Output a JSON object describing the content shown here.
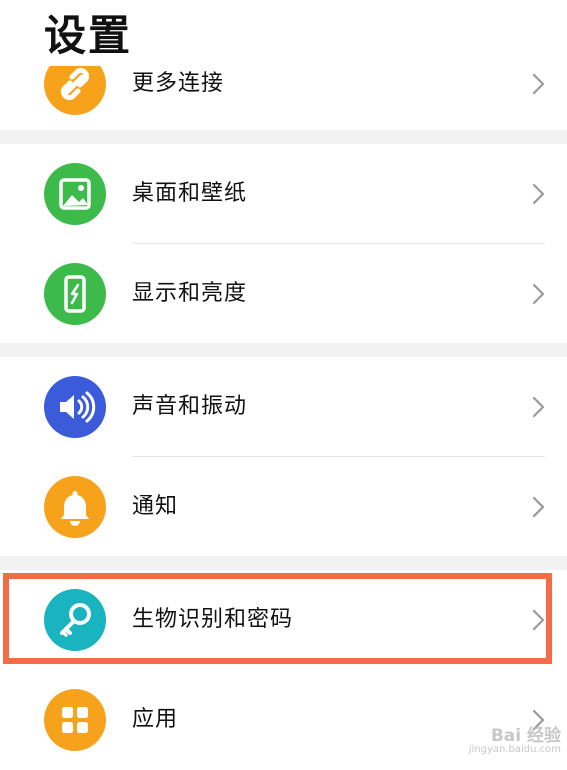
{
  "header": {
    "title": "设置"
  },
  "settings_items": [
    {
      "label": "更多连接",
      "icon": "link-icon",
      "color": "#f7a21b"
    },
    {
      "label": "桌面和壁纸",
      "icon": "image-icon",
      "color": "#3dbb4a"
    },
    {
      "label": "显示和亮度",
      "icon": "phone-brightness-icon",
      "color": "#3dbb4a"
    },
    {
      "label": "声音和振动",
      "icon": "speaker-icon",
      "color": "#3b5bdb"
    },
    {
      "label": "通知",
      "icon": "bell-icon",
      "color": "#f7a21b"
    },
    {
      "label": "生物识别和密码",
      "icon": "key-icon",
      "color": "#1ab3c0"
    },
    {
      "label": "应用",
      "icon": "apps-grid-icon",
      "color": "#f7a21b"
    }
  ],
  "highlight_color": "#f36c45",
  "watermark": {
    "brand": "Bai 经验",
    "url": "jingyan.baidu.com"
  }
}
